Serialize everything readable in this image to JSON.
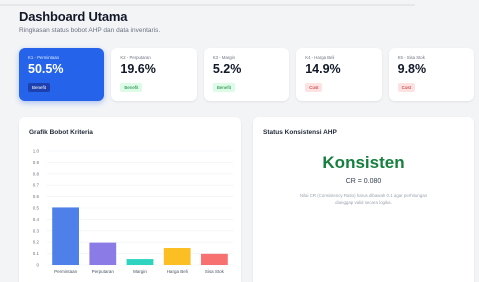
{
  "header": {
    "title": "Dashboard Utama",
    "subtitle": "Ringkasan status bobot AHP dan data inventaris."
  },
  "kpis": [
    {
      "label": "K1 - Permintaan",
      "value": "50.5%",
      "badge": "Benefit",
      "badge_type": "benefit"
    },
    {
      "label": "K2 - Perputaran",
      "value": "19.6%",
      "badge": "Benefit",
      "badge_type": "benefit"
    },
    {
      "label": "K3 - Margin",
      "value": "5.2%",
      "badge": "Benefit",
      "badge_type": "benefit"
    },
    {
      "label": "K4 - Harga Beli",
      "value": "14.9%",
      "badge": "Cost",
      "badge_type": "cost"
    },
    {
      "label": "K5 - Sisa Stok",
      "value": "9.8%",
      "badge": "Cost",
      "badge_type": "cost"
    }
  ],
  "chart_card": {
    "title": "Grafik Bobot Kriteria"
  },
  "status_card": {
    "title": "Status Konsistensi AHP",
    "status": "Konsisten",
    "cr_text": "CR = 0.080",
    "note": "Nilai CR (Consistency Ratio) harus dibawah 0.1 agar perhitungan dianggap valid secara logika."
  },
  "colors": {
    "accent": "#2563eb",
    "success": "#15803d",
    "bars": [
      "#4f7fe8",
      "#8b7be6",
      "#2dd4bf",
      "#fbbf24",
      "#f87171"
    ]
  },
  "chart_data": {
    "type": "bar",
    "categories": [
      "Permintaan",
      "Perputaran",
      "Margin",
      "Harga Beli",
      "Sisa Stok"
    ],
    "values": [
      0.505,
      0.196,
      0.052,
      0.149,
      0.098
    ],
    "ylim": [
      0,
      1.0
    ],
    "yticks": [
      "0",
      "0.1",
      "0.2",
      "0.3",
      "0.4",
      "0.5",
      "0.6",
      "0.7",
      "0.8",
      "0.9",
      "1.0"
    ],
    "grid": true,
    "title": "",
    "xlabel": "",
    "ylabel": ""
  }
}
